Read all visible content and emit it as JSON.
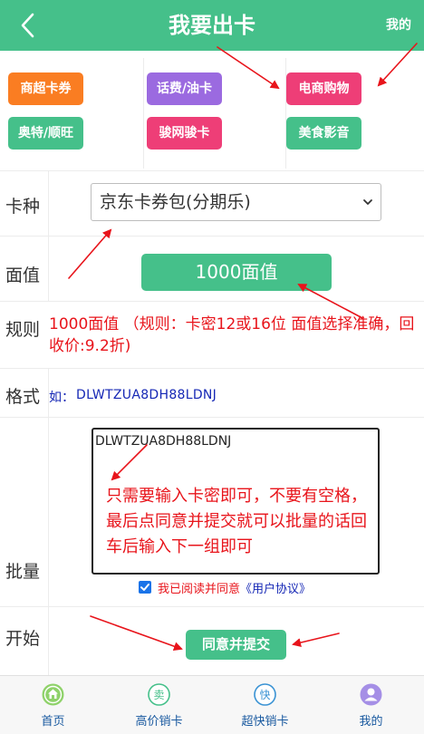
{
  "header": {
    "title": "我要出卡",
    "mine": "我的"
  },
  "categories": [
    {
      "label": "商超卡券",
      "color": "#fa7d22"
    },
    {
      "label": "话费/油卡",
      "color": "#9b6ae0"
    },
    {
      "label": "电商购物",
      "color": "#ee3e77"
    },
    {
      "label": "奥特/顺旺",
      "color": "#45c08a"
    },
    {
      "label": "骏网骏卡",
      "color": "#ee3e77"
    },
    {
      "label": "美食影音",
      "color": "#45c08a"
    }
  ],
  "form": {
    "kind_label": "卡种",
    "kind_value": "京东卡券包(分期乐)",
    "face_label": "面值",
    "face_value": "1000面值",
    "rule_label": "规则",
    "rule_text": "1000面值 （规则：卡密12或16位 面值选择准确，回收价:9.2折)",
    "format_label": "格式",
    "format_prefix": "如：",
    "format_example": "DLWTZUA8DH88LDNJ",
    "batch_label": "批量",
    "batch_value": "DLWTZUA8DH88LDNJ",
    "batch_hint": "只需要输入卡密即可，不要有空格，最后点同意并提交就可以批量的话回车后输入下一组即可",
    "agree_text": "我已阅读并同意",
    "agree_link": "《用户协议》",
    "start_label": "开始",
    "submit_label": "同意并提交"
  },
  "tabs": [
    {
      "label": "首页",
      "icon": "home-icon",
      "glyph": ""
    },
    {
      "label": "高价销卡",
      "icon": "sell-icon",
      "glyph": "卖"
    },
    {
      "label": "超快销卡",
      "icon": "fast-icon",
      "glyph": "快"
    },
    {
      "label": "我的",
      "icon": "user-icon",
      "glyph": ""
    }
  ],
  "colors": {
    "brand": "#45c08a",
    "alert": "#e8141b",
    "link": "#1527b5"
  }
}
